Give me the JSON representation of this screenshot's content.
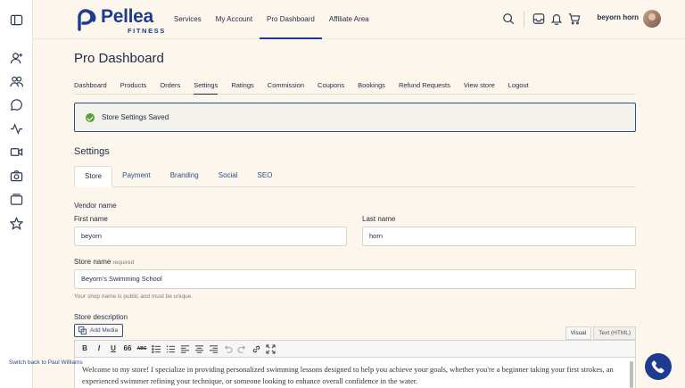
{
  "brand": {
    "name": "Pellea",
    "subtitle": "FITNESS",
    "color": "#1d3c8f"
  },
  "sidebar": {
    "icons": [
      "panel-toggle-icon",
      "user-plus-icon",
      "users-icon",
      "chat-icon",
      "activity-icon",
      "video-icon",
      "camera-icon",
      "folders-icon",
      "star-icon"
    ]
  },
  "header": {
    "nav": [
      {
        "label": "Services"
      },
      {
        "label": "My Account"
      },
      {
        "label": "Pro Dashboard"
      },
      {
        "label": "Affiliate Area"
      }
    ],
    "active_nav": "Pro Dashboard",
    "username": "beyorn horn"
  },
  "main": {
    "title": "Pro Dashboard",
    "subnav": [
      {
        "label": "Dashboard"
      },
      {
        "label": "Products"
      },
      {
        "label": "Orders"
      },
      {
        "label": "Settings"
      },
      {
        "label": "Ratings"
      },
      {
        "label": "Commission"
      },
      {
        "label": "Coupons"
      },
      {
        "label": "Bookings"
      },
      {
        "label": "Refund Requests"
      },
      {
        "label": "View store"
      },
      {
        "label": "Logout"
      }
    ],
    "active_subnav": "Settings",
    "notice": "Store Settings Saved",
    "notice_color": "#5a9f37",
    "section_title": "Settings",
    "tabs": [
      {
        "label": "Store"
      },
      {
        "label": "Payment"
      },
      {
        "label": "Branding"
      },
      {
        "label": "Social"
      },
      {
        "label": "SEO"
      }
    ],
    "active_tab": "Store"
  },
  "form": {
    "vendor_name_label": "Vendor name",
    "first_name_label": "First name",
    "first_name_value": "beyorn",
    "last_name_label": "Last name",
    "last_name_value": "horn",
    "store_name_label": "Store name",
    "store_name_required": "required",
    "store_name_value": "Beyorn's Swimming School",
    "store_name_help": "Your shop name is public and must be unique.",
    "store_description_label": "Store description",
    "add_media_label": "Add Media",
    "editor_tab_visual": "Visual",
    "editor_tab_html": "Text (HTML)",
    "toolbar": {
      "bold": "B",
      "italic": "I",
      "underline": "U",
      "quote": "66",
      "strike": "ABC"
    },
    "description_text": "Welcome to my store! I specialize in providing personalized swimming lessons designed to help you achieve your goals, whether you're a beginner taking your first strokes, an experienced swimmer refining your technique, or someone looking to enhance overall confidence in the water."
  },
  "footer": {
    "switch_back": "Switch back to Paul Williams"
  }
}
